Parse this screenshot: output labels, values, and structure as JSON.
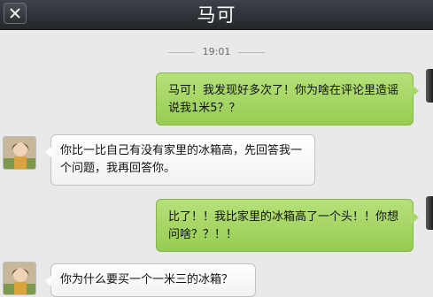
{
  "header": {
    "title": "马可",
    "close_icon": "close-icon"
  },
  "chat": {
    "timestamp": "19:01",
    "messages": [
      {
        "direction": "sent",
        "text": "马可！我发现好多次了！你为啥在评论里造谣说我1米5？？"
      },
      {
        "direction": "received",
        "text": "你比一比自己有没有家里的冰箱高，先回答我一个问题，我再回答你。"
      },
      {
        "direction": "sent",
        "text": "比了！！我比家里的冰箱高了一个头！！你想问啥？？！！"
      },
      {
        "direction": "received",
        "text": "你为什么要买一个一米三的冰箱？"
      }
    ]
  },
  "colors": {
    "header_bg": "#2e3238",
    "chat_bg": "#e9e9e9",
    "sent_bubble": "#a6d867",
    "received_bubble": "#ffffff"
  }
}
